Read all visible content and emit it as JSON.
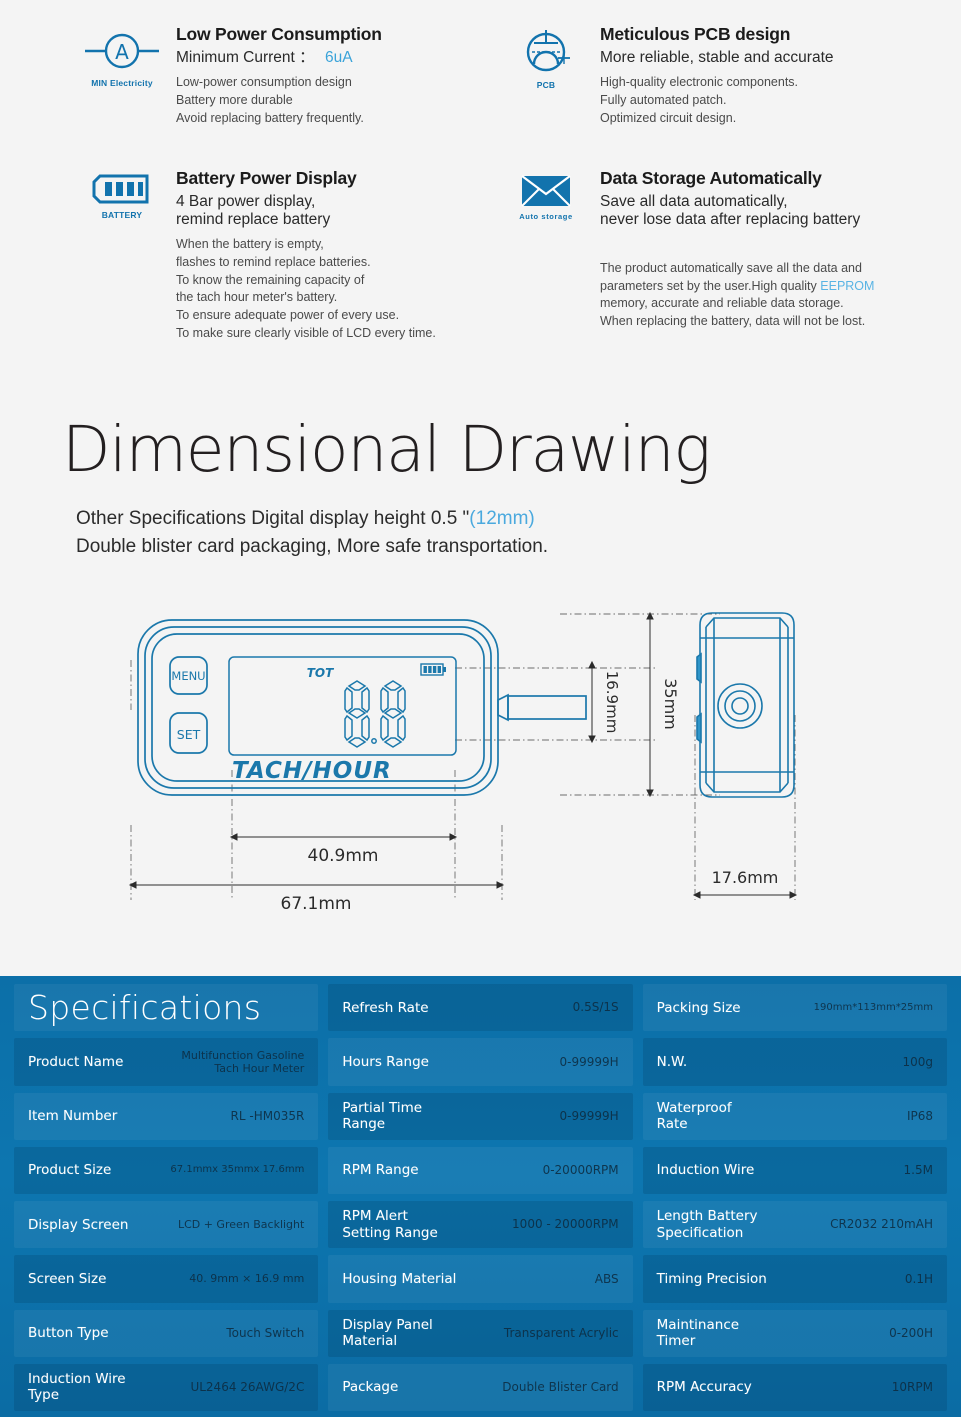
{
  "features": [
    {
      "icon": "ammeter-icon",
      "icon_caption": "MIN Electricity",
      "heading": "Low Power Consumption",
      "subheading_prefix": "Minimum Current ：",
      "subheading_accent": "6uA",
      "body": "Low-power consumption design\nBattery more durable\nAvoid replacing battery frequently."
    },
    {
      "icon": "pcb-icon",
      "icon_caption": "PCB",
      "heading": "Meticulous PCB design",
      "subheading_prefix": "More reliable, stable and accurate",
      "subheading_accent": "",
      "body": "High-quality electronic components.\nFully automated patch.\nOptimized circuit design."
    },
    {
      "icon": "battery-icon",
      "icon_caption": "BATTERY",
      "heading": "Battery Power Display",
      "subheading_prefix": "4 Bar power display,\nremind replace battery",
      "subheading_accent": "",
      "body": "When the battery is empty,\nflashes to remind replace batteries.\nTo know the remaining capacity of\nthe tach hour meter's battery.\nTo ensure adequate power of every use.\nTo make sure clearly visible of LCD every time."
    },
    {
      "icon": "envelope-icon",
      "icon_caption": "Auto  storage",
      "heading": "Data Storage Automatically",
      "subheading_prefix": "Save all data automatically,\nnever lose data after replacing battery",
      "subheading_accent": "",
      "body_part1": "The product automatically save all the data and\nparameters set by the user.High quality ",
      "body_accent": "EEPROM",
      "body_part2": "\nmemory, accurate and reliable data storage.\nWhen replacing the battery, data will not be lost."
    }
  ],
  "dimensional": {
    "title": "Dimensional Drawing",
    "sub_line1_prefix": "Other Specifications Digital display height 0.5 \"",
    "sub_line1_accent": "(12mm)",
    "sub_line2": "Double blister card packaging, More safe transportation.",
    "drawing": {
      "menu_button": "MENU",
      "set_button": "SET",
      "lcd_tot": "TOT",
      "lcd_value": "0.0",
      "brand": "TACH/HOUR",
      "dim_width_total": "67.1mm",
      "dim_width_screen": "40.9mm",
      "dim_height_screen": "16.9mm",
      "dim_height_total": "35mm",
      "dim_depth": "17.6mm"
    }
  },
  "specifications": {
    "title": "Specifications",
    "col1": [
      {
        "label": "Product Name",
        "value": "Multifunction Gasoline\nTach Hour Meter",
        "size": "sm"
      },
      {
        "label": "Item Number",
        "value": "RL -HM035R",
        "size": "md"
      },
      {
        "label": "Product Size",
        "value": "67.1mmx 35mmx 17.6mm",
        "size": "xs"
      },
      {
        "label": "Display Screen",
        "value": "LCD + Green Backlight",
        "size": "sm"
      },
      {
        "label": "Screen Size",
        "value": "40. 9mm × 16.9 mm",
        "size": "sm"
      },
      {
        "label": "Button Type",
        "value": "Touch Switch",
        "size": "md"
      },
      {
        "label": "Induction Wire\nType",
        "value": "UL2464 26AWG/2C",
        "size": "md"
      }
    ],
    "col2": [
      {
        "label": "Refresh Rate",
        "value": "0.5S/1S",
        "size": "md"
      },
      {
        "label": "Hours Range",
        "value": "0-99999H",
        "size": "md"
      },
      {
        "label": "Partial Time\nRange",
        "value": "0-99999H",
        "size": "md"
      },
      {
        "label": "RPM Range",
        "value": "0-20000RPM",
        "size": "md"
      },
      {
        "label": "RPM Alert\nSetting Range",
        "value": "1000 - 20000RPM",
        "size": "md"
      },
      {
        "label": "Housing Material",
        "value": "ABS",
        "size": "md"
      },
      {
        "label": "Display Panel\nMaterial",
        "value": "Transparent Acrylic",
        "size": "md"
      },
      {
        "label": "Package",
        "value": "Double Blister Card",
        "size": "md"
      }
    ],
    "col3": [
      {
        "label": "Packing Size",
        "value": "190mm*113mm*25mm",
        "size": "xs"
      },
      {
        "label": "N.W.",
        "value": "100g",
        "size": "md"
      },
      {
        "label": "Waterproof\nRate",
        "value": "IP68",
        "size": "md"
      },
      {
        "label": "Induction Wire",
        "value": "1.5M",
        "size": "md"
      },
      {
        "label": "Length  Battery\nSpecification",
        "value": "CR2032 210mAH",
        "size": "md"
      },
      {
        "label": "Timing  Precision",
        "value": "0.1H",
        "size": "md"
      },
      {
        "label": "Maintinance\nTimer",
        "value": "0-200H",
        "size": "md"
      },
      {
        "label": "RPM  Accuracy",
        "value": "10RPM",
        "size": "md"
      }
    ]
  },
  "colors": {
    "brand_blue": "#1273ad",
    "accent_light_blue": "#4aa9de",
    "table_blue": "#0d76b0",
    "drawing_stroke": "#1b78ab"
  }
}
